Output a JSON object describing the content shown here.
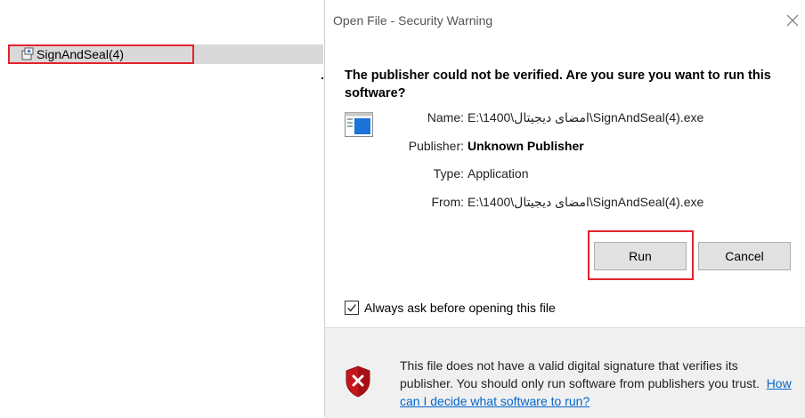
{
  "explorer": {
    "file_name": "SignAndSeal(4)"
  },
  "dialog": {
    "title": "Open File - Security Warning",
    "heading": "The publisher could not be verified.  Are you sure you want to run this software?",
    "fields": {
      "name_label": "Name:",
      "name_value": "E:\\1400\\امضای دیجیتال\\SignAndSeal(4).exe",
      "publisher_label": "Publisher:",
      "publisher_value": "Unknown Publisher",
      "type_label": "Type:",
      "type_value": "Application",
      "from_label": "From:",
      "from_value": "E:\\1400\\امضای دیجیتال\\SignAndSeal(4).exe"
    },
    "buttons": {
      "run": "Run",
      "cancel": "Cancel"
    },
    "always_ask": {
      "label": "Always ask before opening this file",
      "checked": true
    },
    "warning": {
      "text": "This file does not have a valid digital signature that verifies its publisher.  You should only run software from publishers you trust.",
      "link": "How can I decide what software to run?"
    }
  },
  "colors": {
    "highlight": "#e3232c",
    "link": "#0066cc",
    "footer": "#f0f0f0"
  }
}
